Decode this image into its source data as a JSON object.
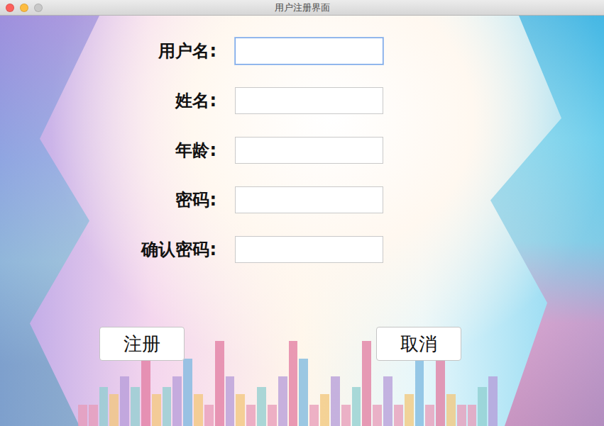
{
  "window": {
    "title": "用户注册界面",
    "controls": [
      {
        "name": "close",
        "color": "#fc605c"
      },
      {
        "name": "minimize",
        "color": "#fdbc40"
      },
      {
        "name": "zoom",
        "color": "#c8c8c8"
      }
    ]
  },
  "form": {
    "fields": [
      {
        "label": "用户名:",
        "value": "",
        "focused": true
      },
      {
        "label": "姓名:",
        "value": "",
        "focused": false
      },
      {
        "label": "年龄:",
        "value": "",
        "focused": false
      },
      {
        "label": "密码:",
        "value": "",
        "focused": false
      },
      {
        "label": "确认密码:",
        "value": "",
        "focused": false
      }
    ]
  },
  "buttons": [
    "注册",
    "取消"
  ]
}
